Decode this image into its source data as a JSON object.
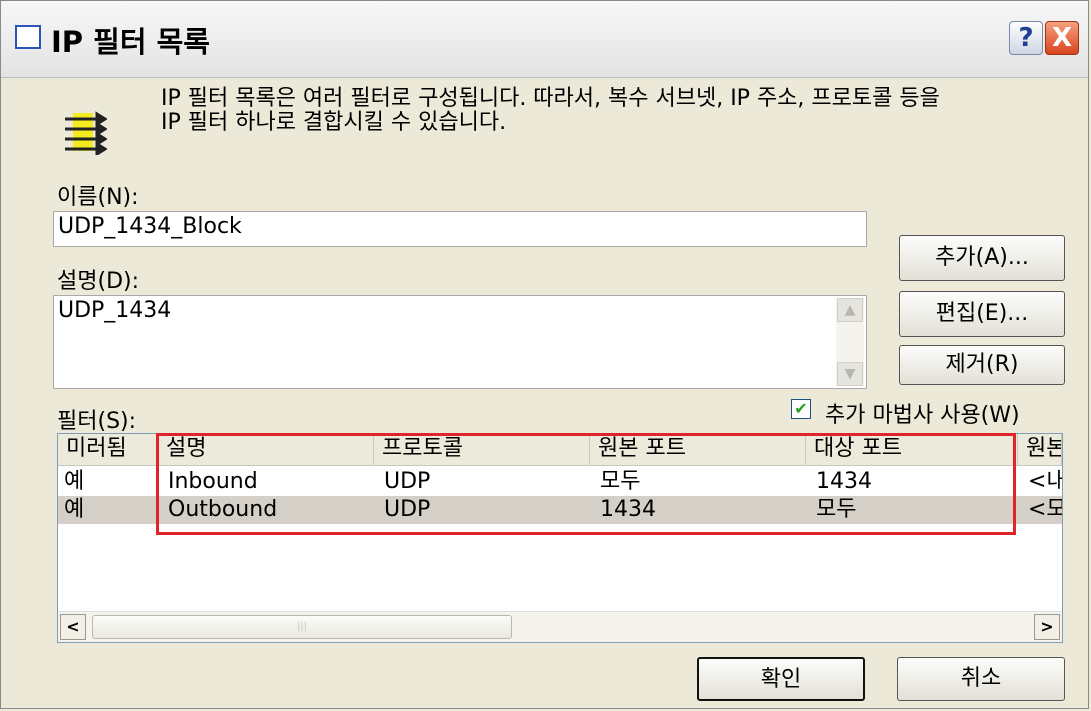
{
  "window": {
    "title": "IP 필터 목록",
    "help_label": "?",
    "close_label": "X"
  },
  "description": {
    "line1": "IP 필터 목록은 여러 필터로 구성됩니다. 따라서, 복수 서브넷, IP 주소, 프로토콜 등을",
    "line2": "IP 필터 하나로 결합시킬 수 있습니다."
  },
  "name_field": {
    "label": "이름(N):",
    "value": "UDP_1434_Block"
  },
  "desc_field": {
    "label": "설명(D):",
    "value": "UDP_1434"
  },
  "buttons": {
    "add": "추가(A)...",
    "edit": "편집(E)...",
    "remove": "제거(R)",
    "ok": "확인",
    "cancel": "취소"
  },
  "filters": {
    "label": "필터(S):",
    "wizard_label": "추가 마법사 사용(W)",
    "wizard_checked": true,
    "columns": [
      "미러됨",
      "설명",
      "프로토콜",
      "원본 포트",
      "대상 포트",
      "원본"
    ],
    "rows": [
      [
        "예",
        "Inbound",
        "UDP",
        "모두",
        "1434",
        "<내"
      ],
      [
        "예",
        "Outbound",
        "UDP",
        "1434",
        "모두",
        "<모"
      ]
    ],
    "selected_row": 1
  },
  "colors": {
    "highlight_box": "#e0232c",
    "selected_row": "#d4d0c8",
    "title_icon": "#2b55b8"
  }
}
